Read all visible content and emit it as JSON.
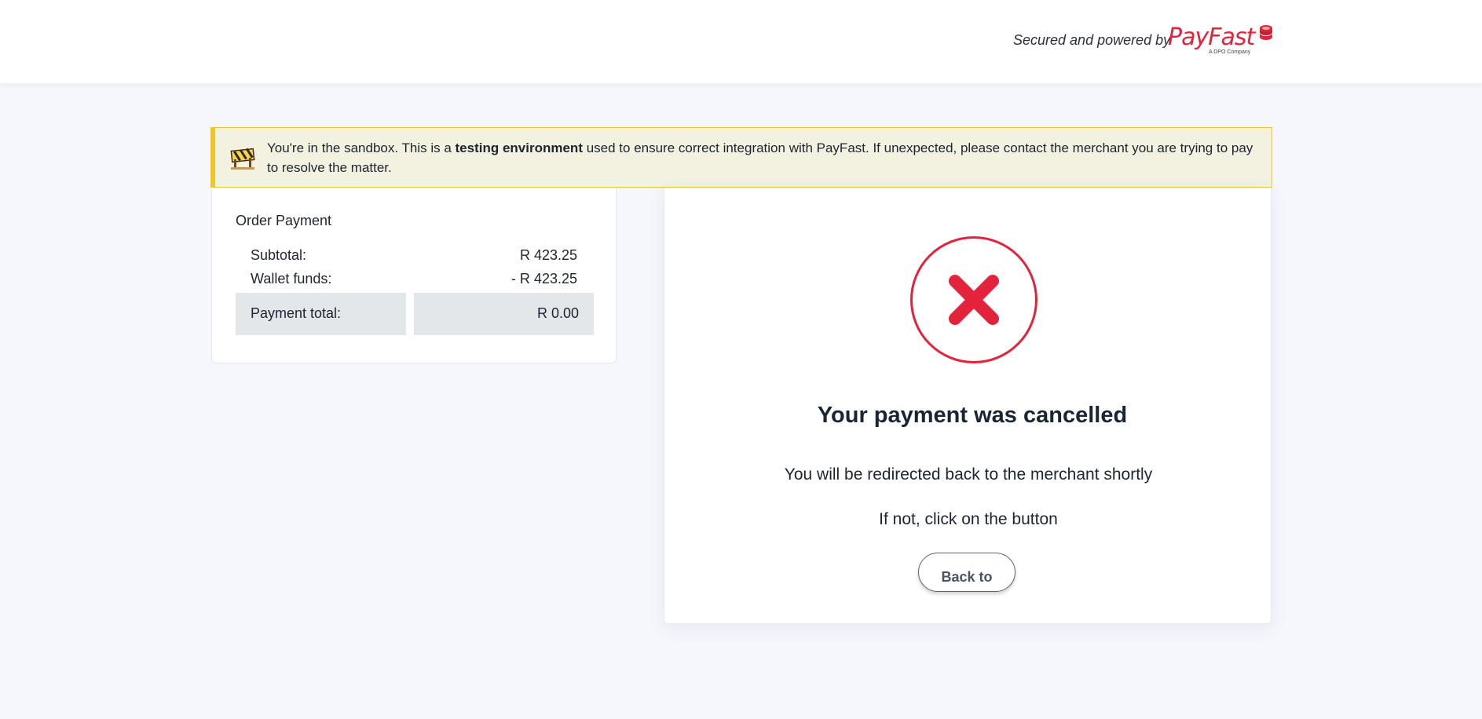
{
  "header": {
    "secured_text": "Secured and powered by",
    "logo_word": "PayFast",
    "logo_subtitle": "A DPO Company"
  },
  "banner": {
    "text_before": "You're in the sandbox. This is a ",
    "text_bold": "testing environment",
    "text_after": " used to ensure correct integration with PayFast. If unexpected, please contact the merchant you are trying to pay to resolve the matter.",
    "icon": "construction-barrier-icon"
  },
  "order": {
    "title": "Order Payment",
    "rows": [
      {
        "label": "Subtotal:",
        "value": "R 423.25"
      },
      {
        "label": "Wallet funds:",
        "value": "- R 423.25"
      }
    ],
    "total_label": "Payment total:",
    "total_value": "R 0.00"
  },
  "result": {
    "icon": "cancel-x-icon",
    "title": "Your payment was cancelled",
    "message": "You will be redirected back to the merchant shortly",
    "prompt": "If not, click on the button",
    "button_label": "Back to"
  },
  "colors": {
    "brand_red": "#e2233b",
    "banner_bg": "#f3f1df",
    "banner_border": "#efc72a",
    "page_bg": "#f6f7fc"
  }
}
